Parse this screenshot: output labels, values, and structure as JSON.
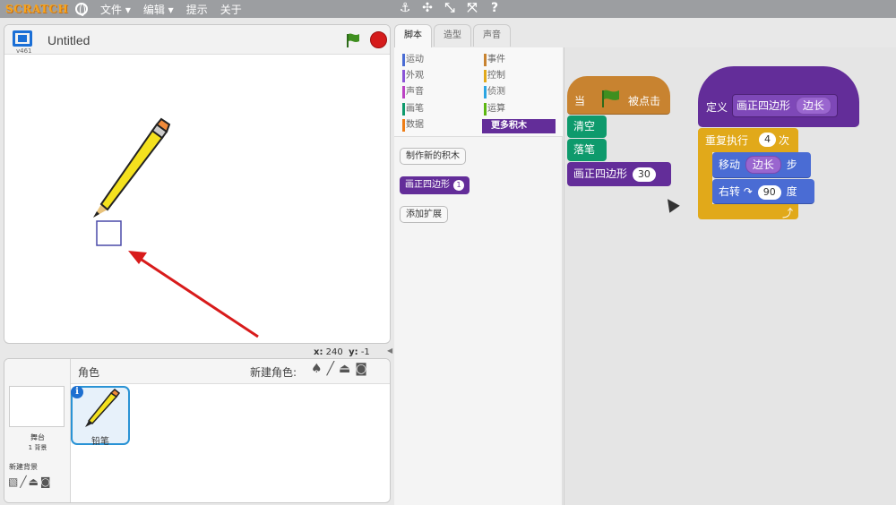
{
  "app": {
    "logo": "SCRATCH",
    "menu": {
      "file": "文件 ▾",
      "edit": "编辑 ▾",
      "tips": "提示",
      "about": "关于"
    },
    "toolbar_icons": [
      "duplicate-icon",
      "cut-icon",
      "grow-icon",
      "shrink-icon",
      "help-icon"
    ]
  },
  "stage": {
    "version": "v461",
    "title": "Untitled",
    "coords": {
      "x_label": "x:",
      "x": "240",
      "y_label": "y:",
      "y": "-1"
    }
  },
  "sprites": {
    "stage_label": "舞台",
    "bg_count": "1 背景",
    "new_backdrop": "新建背景",
    "header": "角色",
    "new_sprite": "新建角色:",
    "items": [
      {
        "name": "铅笔"
      }
    ]
  },
  "tabs": [
    {
      "label": "脚本",
      "active": true
    },
    {
      "label": "造型",
      "active": false
    },
    {
      "label": "声音",
      "active": false
    }
  ],
  "categories": [
    {
      "label": "运动",
      "color": "#4a6cd4"
    },
    {
      "label": "外观",
      "color": "#8a55d7"
    },
    {
      "label": "声音",
      "color": "#bb42c3"
    },
    {
      "label": "画笔",
      "color": "#0e9a6c"
    },
    {
      "label": "数据",
      "color": "#ee7d16"
    },
    {
      "label": "事件",
      "color": "#c88330"
    },
    {
      "label": "控制",
      "color": "#e1a91a"
    },
    {
      "label": "侦测",
      "color": "#2ca5e2"
    },
    {
      "label": "运算",
      "color": "#5cb712"
    },
    {
      "label": "更多积木",
      "color": "#632d99"
    }
  ],
  "palette": {
    "make_block": "制作新的积木",
    "custom_block": "画正四边形",
    "custom_block_param": "1",
    "add_extension": "添加扩展"
  },
  "scripts": {
    "hat": {
      "when": "当",
      "clicked": "被点击"
    },
    "clear": "清空",
    "pen_down": "落笔",
    "call": {
      "label": "画正四边形",
      "arg": "30"
    },
    "define": {
      "label": "定义",
      "name": "画正四边形",
      "param": "边长"
    },
    "repeat": {
      "label": "重复执行",
      "times": "4",
      "unit": "次"
    },
    "move": {
      "label": "移动",
      "param": "边长",
      "unit": "步"
    },
    "turn": {
      "label": "右转",
      "degrees": "90",
      "unit": "度"
    }
  }
}
